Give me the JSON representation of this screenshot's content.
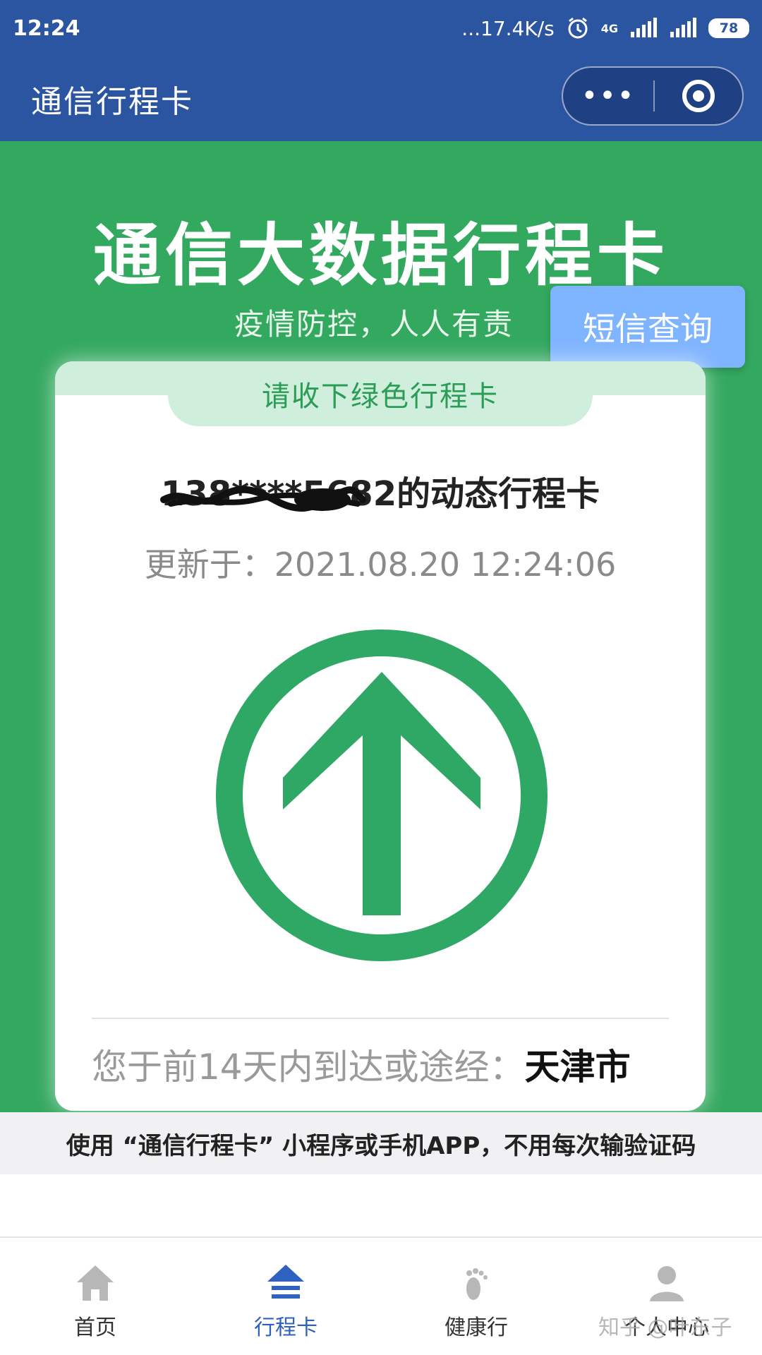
{
  "status_bar": {
    "time": "12:24",
    "net_speed": "...17.4K/s",
    "network": "4G",
    "battery": "78"
  },
  "title_bar": {
    "title": "通信行程卡",
    "more_label": "•••"
  },
  "hero": {
    "title": "通信大数据行程卡",
    "subtitle": "疫情防控，人人有责"
  },
  "sms_button": "短信查询",
  "card": {
    "tab_label": "请收下绿色行程卡",
    "phone": "138****5682",
    "phone_suffix": "的动态行程卡",
    "updated_label": "更新于：",
    "updated_time": "2021.08.20 12:24:06",
    "status_color": "#2fa865",
    "visited_label": "您于前14天内到达或途经：",
    "visited_city": "天津市"
  },
  "notice": "使用 “通信行程卡” 小程序或手机APP，不用每次输验证码",
  "nav": {
    "items": [
      {
        "label": "首页",
        "icon": "home-icon",
        "active": false
      },
      {
        "label": "行程卡",
        "icon": "arrow-up-stack-icon",
        "active": true
      },
      {
        "label": "健康行",
        "icon": "footprint-icon",
        "active": false
      },
      {
        "label": "个人中心",
        "icon": "person-icon",
        "active": false
      }
    ],
    "active_color": "#2f62c0"
  },
  "watermark": "知乎 @叶东子",
  "colors": {
    "header_blue": "#2b55a0",
    "main_green": "#33a85f",
    "sms_blue": "#7fb4ff"
  }
}
